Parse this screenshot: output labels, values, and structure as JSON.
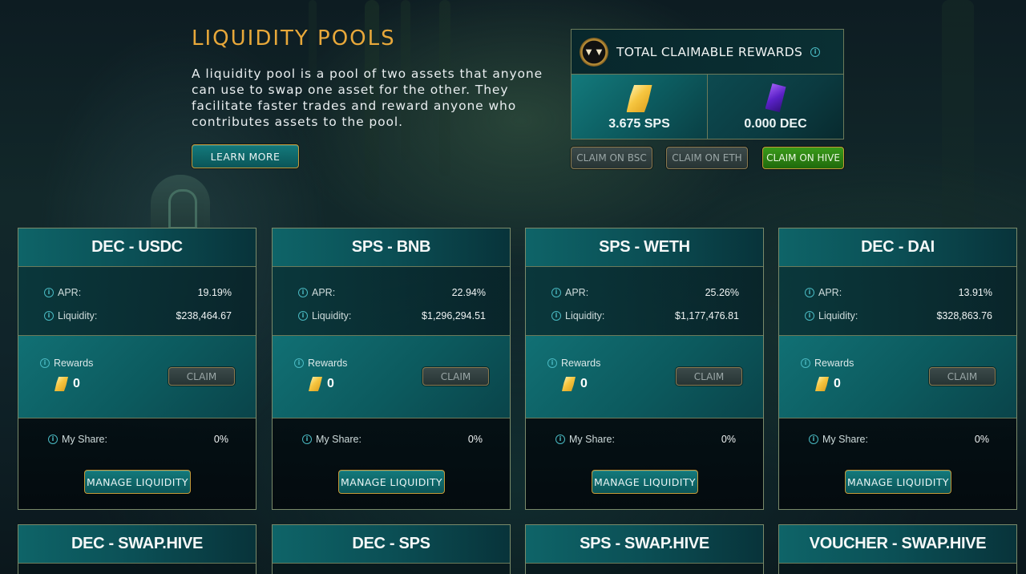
{
  "header": {
    "title": "LIQUIDITY POOLS",
    "description": "A liquidity pool is a pool of two assets that anyone can use to swap one asset for the other. They facilitate faster trades and reward anyone who contributes assets to the pool.",
    "learn_more_label": "LEARN MORE"
  },
  "rewards_panel": {
    "title": "TOTAL CLAIMABLE REWARDS",
    "sps_value": "3.675 SPS",
    "dec_value": "0.000 DEC",
    "claim_bsc_label": "CLAIM ON BSC",
    "claim_eth_label": "CLAIM ON ETH",
    "claim_hive_label": "CLAIM ON HIVE",
    "accent_color": "#e8a83a",
    "claim_hive_color": "#2f8a14"
  },
  "labels": {
    "apr": "APR:",
    "liquidity": "Liquidity:",
    "rewards": "Rewards",
    "claim": "CLAIM",
    "my_share": "My Share:",
    "manage": "MANAGE LIQUIDITY"
  },
  "pools": [
    {
      "name": "DEC - USDC",
      "apr": "19.19%",
      "liquidity": "$238,464.67",
      "rewards": "0",
      "share": "0%"
    },
    {
      "name": "SPS - BNB",
      "apr": "22.94%",
      "liquidity": "$1,296,294.51",
      "rewards": "0",
      "share": "0%"
    },
    {
      "name": "SPS - WETH",
      "apr": "25.26%",
      "liquidity": "$1,177,476.81",
      "rewards": "0",
      "share": "0%"
    },
    {
      "name": "DEC - DAI",
      "apr": "13.91%",
      "liquidity": "$328,863.76",
      "rewards": "0",
      "share": "0%"
    },
    {
      "name": "DEC - SWAP.HIVE"
    },
    {
      "name": "DEC - SPS"
    },
    {
      "name": "SPS - SWAP.HIVE"
    },
    {
      "name": "VOUCHER - SWAP.HIVE"
    }
  ],
  "icons": {
    "info": "info-icon",
    "sps": "sps-token-icon",
    "dec": "dec-token-icon",
    "logo": "splinterlands-logo-icon"
  }
}
